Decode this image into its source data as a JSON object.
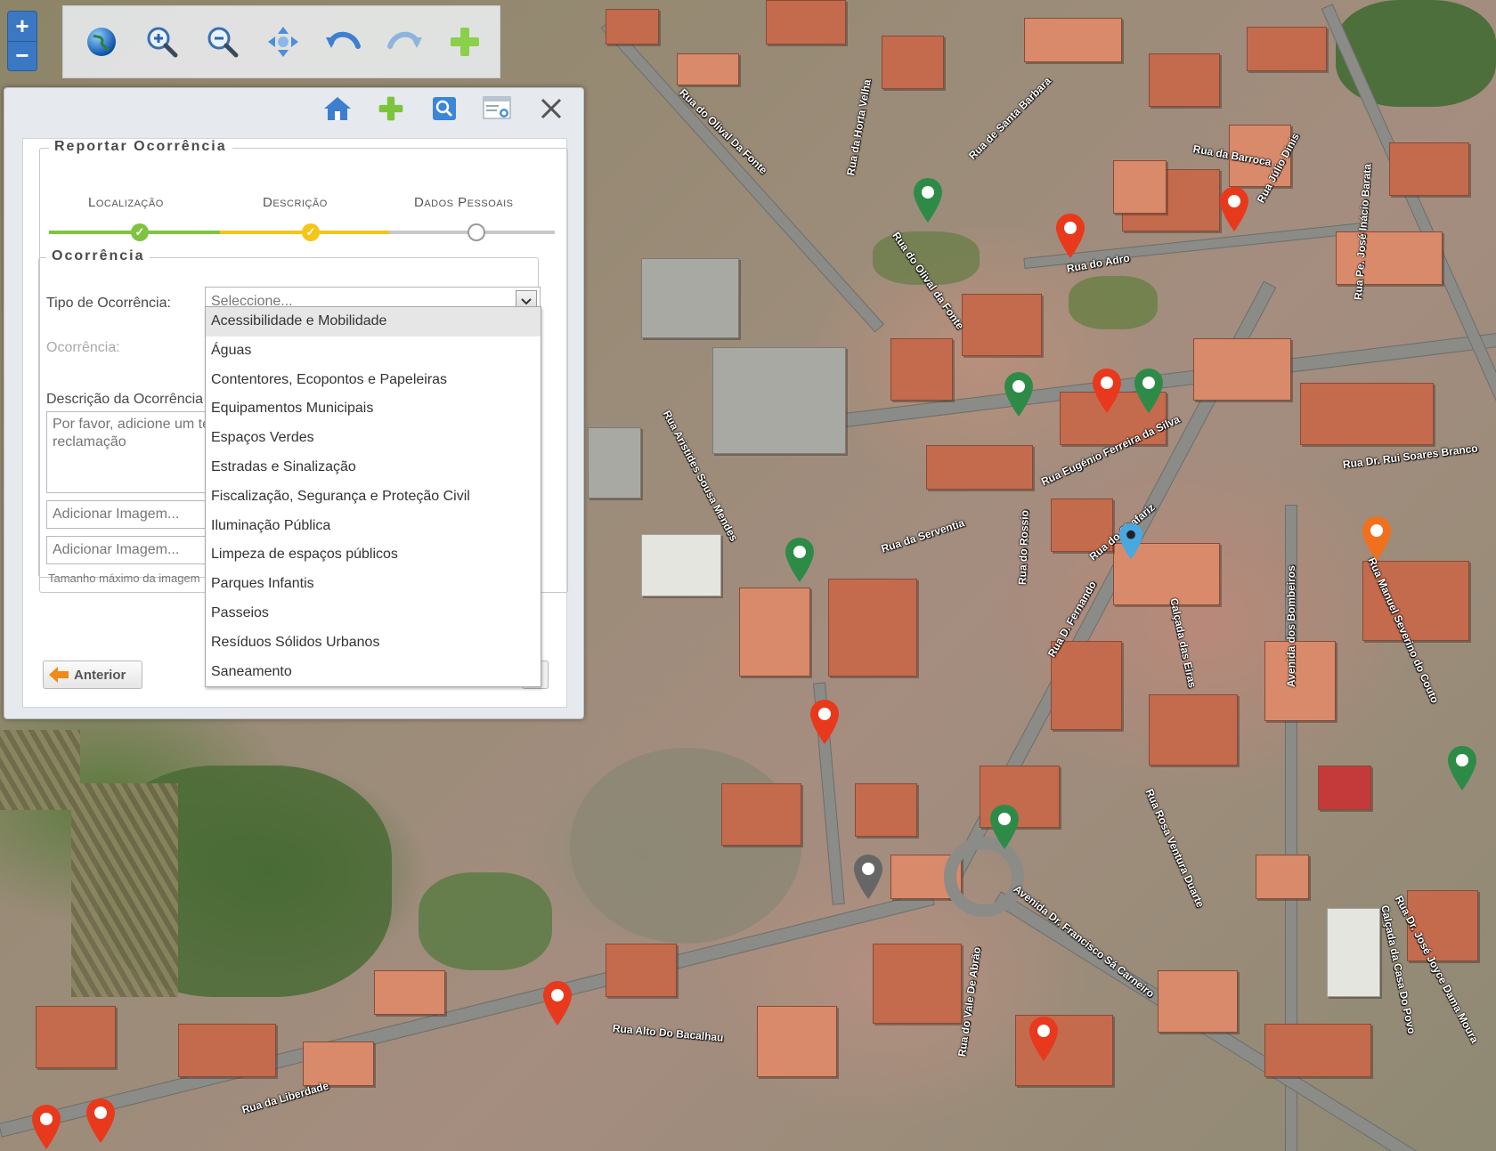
{
  "map": {
    "streets": [
      {
        "label": "Rua do Olival Da Fonte"
      },
      {
        "label": "Rua da Horta Velha"
      },
      {
        "label": "Rua de Santa Barbara"
      },
      {
        "label": "Rua da Barroca"
      },
      {
        "label": "Rua Júlio Dinis"
      },
      {
        "label": "Rua Pe. José Inácio Barata"
      },
      {
        "label": "Rua do Adro"
      },
      {
        "label": "Rua do Olival da Fonte"
      },
      {
        "label": "Rua Eugénio Ferreira da Silva"
      },
      {
        "label": "Rua Dr. Rui Soares Branco"
      },
      {
        "label": "Rua da Serventia"
      },
      {
        "label": "Rua do Rossio"
      },
      {
        "label": "Rua do Chafariz"
      },
      {
        "label": "Rua D. Fernando"
      },
      {
        "label": "Calçada das Eiras"
      },
      {
        "label": "Avenida dos Bombeiros"
      },
      {
        "label": "Rua Alto Do Bacalhau"
      },
      {
        "label": "Rua da Liberdade"
      },
      {
        "label": "Avenida Dr. Francisco Sá Carneiro"
      },
      {
        "label": "Rua do Vale De Abrão"
      },
      {
        "label": "Rua Rosa Ventura Duarte"
      },
      {
        "label": "Rua Dr. José Joyce Dama Moura"
      },
      {
        "label": "Calçada da Casa Do Povo"
      },
      {
        "label": "Rua Manuel Severino do Couto"
      },
      {
        "label": "Rua Aristides Sousa Mendes"
      }
    ],
    "colors": {
      "red": "#e8391d",
      "green": "#2e8b47",
      "orange": "#f07020",
      "blue": "#4aa8e0",
      "grey": "#666666"
    }
  },
  "zoom": {
    "in_label": "+",
    "out_label": "−"
  },
  "toolbar": {
    "icons": [
      "globe-icon",
      "zoom-in-icon",
      "zoom-out-icon",
      "pan-icon",
      "undo-icon",
      "redo-icon",
      "add-icon"
    ]
  },
  "dialog": {
    "header_icons": [
      "home-icon",
      "add-icon",
      "search-icon",
      "list-search-icon",
      "close-icon"
    ],
    "form_title": "Reportar Ocorrência",
    "steps": [
      {
        "label": "Localização",
        "state": "done"
      },
      {
        "label": "Descrição",
        "state": "done"
      },
      {
        "label": "Dados Pessoais",
        "state": "pending"
      }
    ],
    "section_title": "Ocorrência",
    "type_label": "Tipo de Ocorrência:",
    "type_placeholder": "Seleccione...",
    "occurrence_label": "Ocorrência:",
    "description_label": "Descrição da Ocorrência",
    "description_placeholder": "Por favor, adicione um texto detalhado para acelerar a sua reclamação",
    "image_input_1": "Adicionar Imagem...",
    "image_input_2": "Adicionar Imagem...",
    "max_size_hint": "Tamanho máximo da imagem",
    "prev_button": "Anterior",
    "dropdown_options": [
      "Acessibilidade e Mobilidade",
      "Águas",
      "Contentores, Ecopontos e Papeleiras",
      "Equipamentos Municipais",
      "Espaços Verdes",
      "Estradas e Sinalização",
      "Fiscalização, Segurança e Proteção Civil",
      "Iluminação Pública",
      "Limpeza de espaços públicos",
      "Parques Infantis",
      "Passeios",
      "Resíduos Sólidos Urbanos",
      "Saneamento"
    ],
    "highlighted_option": "Acessibilidade e Mobilidade"
  }
}
